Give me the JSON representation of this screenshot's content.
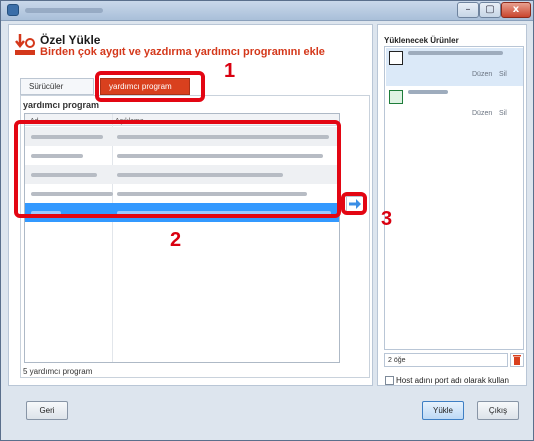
{
  "window": {
    "min_label": "–",
    "max_label": "▢",
    "close_label": "x"
  },
  "header": {
    "title": "Özel Yükle",
    "subtitle": "Birden çok aygıt ve yazdırma yardımcı programını ekle"
  },
  "tabs": [
    {
      "label": "Sürücüler",
      "active": false
    },
    {
      "label": "yardımcı program",
      "active": true
    }
  ],
  "utility_section": {
    "label": "yardımcı program",
    "columns": [
      "Ad",
      "Açıklama"
    ],
    "count_label": "5 yardımcı program"
  },
  "products_panel": {
    "title": "Yüklenecek Ürünler",
    "edit_label": "Düzen",
    "delete_label": "Sil",
    "item_count": "2 öğe"
  },
  "options": {
    "hostname_label": "Host adını port adı olarak kullan"
  },
  "buttons": {
    "back": "Geri",
    "install": "Yükle",
    "exit": "Çıkış"
  },
  "annotations": [
    "1",
    "2",
    "3"
  ],
  "colors": {
    "accent": "#d9401e",
    "selection": "#3399ff",
    "highlight": "#e30613"
  }
}
